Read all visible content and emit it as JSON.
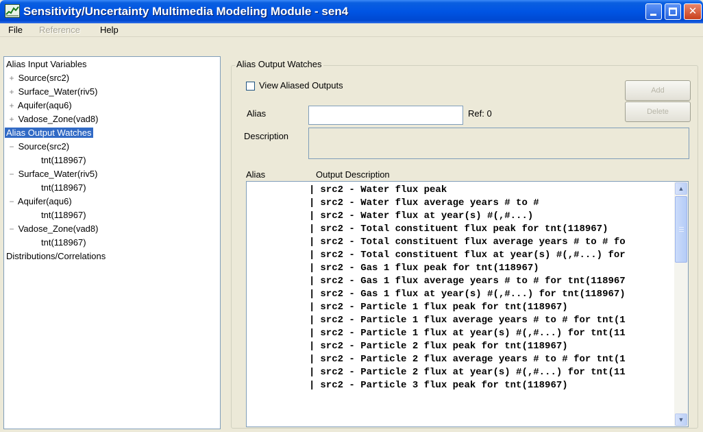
{
  "window": {
    "title": "Sensitivity/Uncertainty Multimedia Modeling Module - sen4",
    "app_icon": "chart-icon"
  },
  "menu": {
    "file": "File",
    "reference": "Reference",
    "help": "Help"
  },
  "tree": {
    "nodes": [
      {
        "label": "Alias Input Variables",
        "expander": ""
      },
      {
        "label": "Source(src2)",
        "expander": "+"
      },
      {
        "label": "Surface_Water(riv5)",
        "expander": "+"
      },
      {
        "label": "Aquifer(aqu6)",
        "expander": "+"
      },
      {
        "label": "Vadose_Zone(vad8)",
        "expander": "+"
      },
      {
        "label": "Alias Output Watches",
        "expander": ""
      },
      {
        "label": "Source(src2)",
        "expander": "−"
      },
      {
        "label": "tnt(118967)",
        "expander": ""
      },
      {
        "label": "Surface_Water(riv5)",
        "expander": "−"
      },
      {
        "label": "tnt(118967)",
        "expander": ""
      },
      {
        "label": "Aquifer(aqu6)",
        "expander": "−"
      },
      {
        "label": "tnt(118967)",
        "expander": ""
      },
      {
        "label": "Vadose_Zone(vad8)",
        "expander": "−"
      },
      {
        "label": "tnt(118967)",
        "expander": ""
      },
      {
        "label": "Distributions/Correlations",
        "expander": ""
      }
    ]
  },
  "panel": {
    "group_title": "Alias Output Watches",
    "view_aliased_label": "View Aliased Outputs",
    "view_aliased_checked": false,
    "alias_label": "Alias",
    "alias_value": "",
    "ref_label": "Ref: 0",
    "description_label": "Description",
    "button_add": "Add",
    "button_delete": "Delete",
    "col_alias": "Alias",
    "col_description": "Output Description"
  },
  "outputs": [
    "src2 - Water flux peak",
    "src2 - Water flux average years # to #",
    "src2 - Water flux at year(s) #(,#...)",
    "src2 - Total constituent flux peak for tnt(118967)",
    "src2 - Total constituent flux average years # to # fo",
    "src2 - Total constituent flux at year(s) #(,#...) for",
    "src2 - Gas 1 flux peak for tnt(118967)",
    "src2 - Gas 1 flux average years # to # for tnt(118967",
    "src2 - Gas 1 flux at year(s) #(,#...) for tnt(118967)",
    "src2 - Particle 1 flux peak for tnt(118967)",
    "src2 - Particle 1 flux average years # to # for tnt(1",
    "src2 - Particle 1 flux at year(s) #(,#...) for tnt(11",
    "src2 - Particle 2 flux peak for tnt(118967)",
    "src2 - Particle 2 flux average years # to # for tnt(1",
    "src2 - Particle 2 flux at year(s) #(,#...) for tnt(11",
    "src2 - Particle 3 flux peak for tnt(118967)"
  ]
}
